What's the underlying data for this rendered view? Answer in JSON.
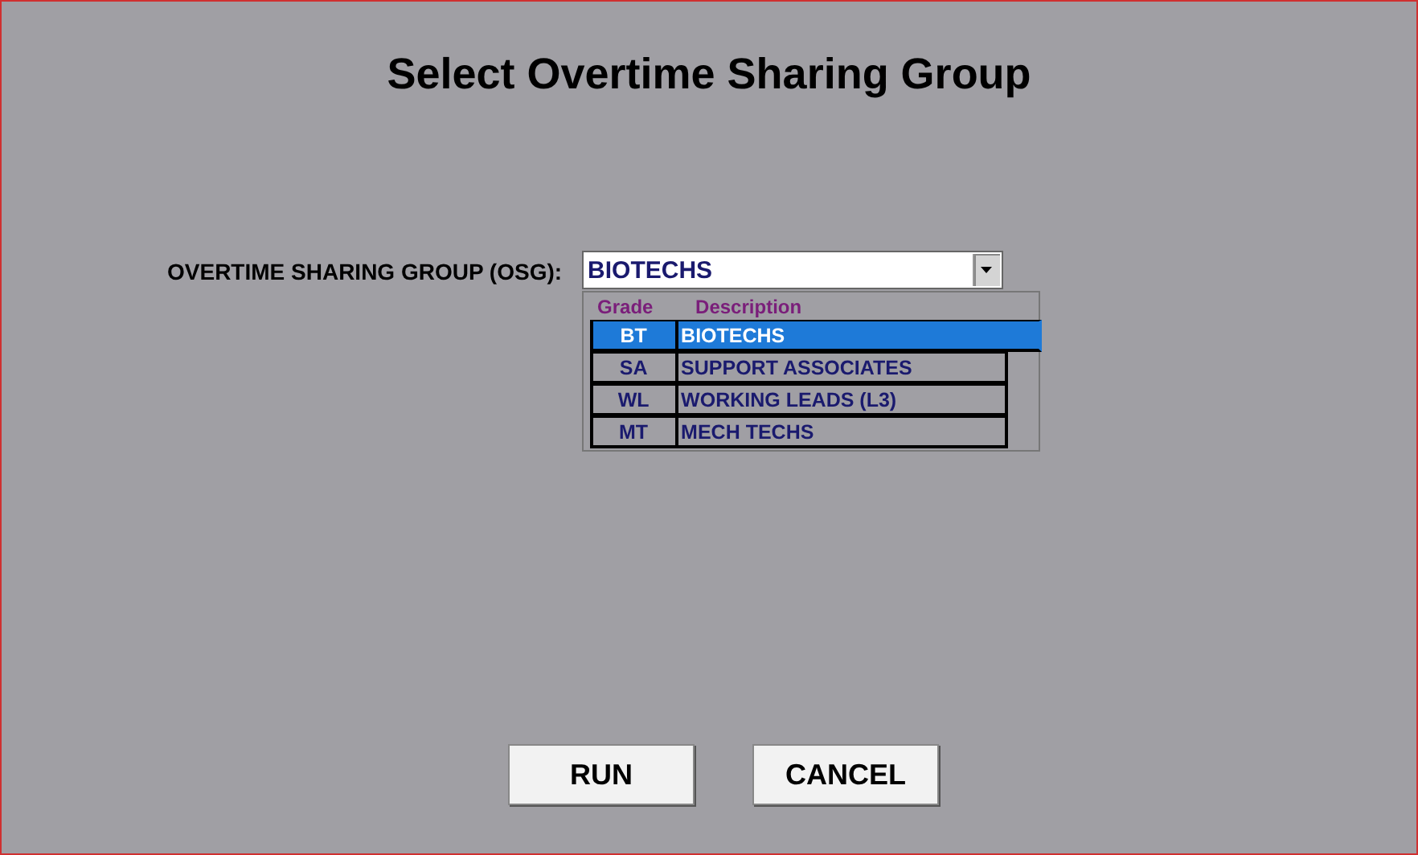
{
  "title": "Select Overtime Sharing Group",
  "field": {
    "label": "OVERTIME SHARING GROUP (OSG):",
    "value": "BIOTECHS",
    "expanded": true
  },
  "dropdown": {
    "columns": [
      "Grade",
      "Description"
    ],
    "rows": [
      {
        "grade": "BT",
        "description": "BIOTECHS",
        "selected": true
      },
      {
        "grade": "SA",
        "description": "SUPPORT ASSOCIATES",
        "selected": false
      },
      {
        "grade": "WL",
        "description": "WORKING LEADS (L3)",
        "selected": false
      },
      {
        "grade": "MT",
        "description": "MECH TECHS",
        "selected": false
      }
    ]
  },
  "buttons": [
    "RUN",
    "CANCEL"
  ]
}
